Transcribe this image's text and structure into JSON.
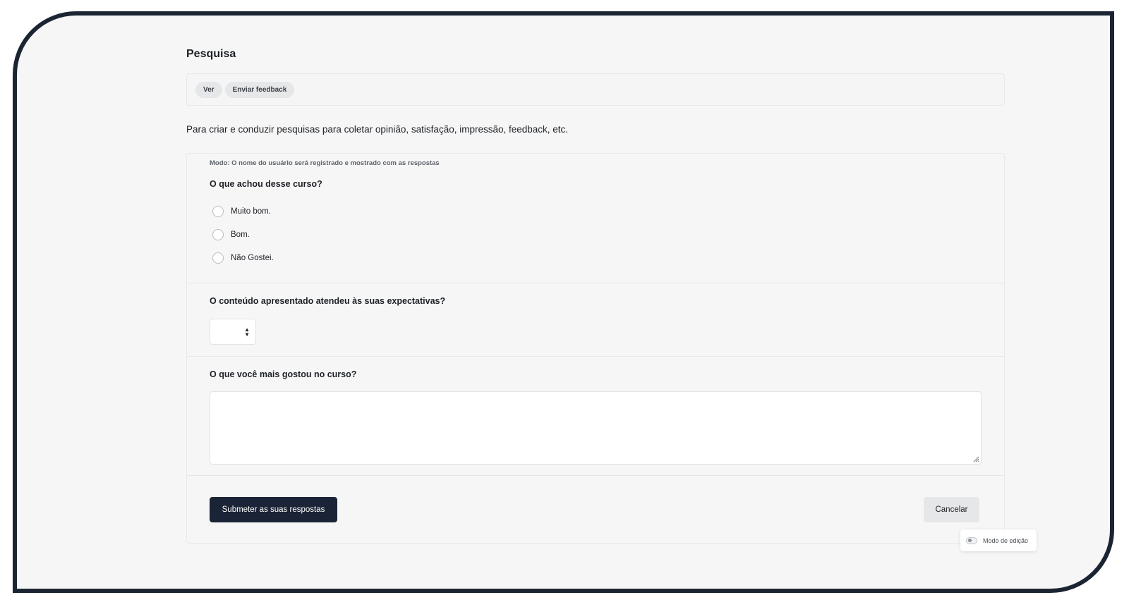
{
  "page": {
    "title": "Pesquisa",
    "description": "Para criar e conduzir pesquisas para coletar opinião, satisfação, impressão, feedback, etc."
  },
  "tabs": [
    {
      "label": "Ver"
    },
    {
      "label": "Enviar feedback"
    }
  ],
  "form": {
    "mode_note": "Modo: O nome do usuário será registrado e mostrado com as respostas",
    "questions": [
      {
        "title": "O que achou desse curso?",
        "type": "radio",
        "options": [
          "Muito bom.",
          "Bom.",
          "Não Gostei."
        ]
      },
      {
        "title": "O conteúdo apresentado atendeu às suas expectativas?",
        "type": "select",
        "value": ""
      },
      {
        "title": "O que você mais gostou no curso?",
        "type": "textarea",
        "value": ""
      }
    ],
    "submit_label": "Submeter as suas respostas",
    "cancel_label": "Cancelar"
  },
  "edit_mode": {
    "label": "Modo de edição",
    "enabled": false
  },
  "colors": {
    "primary_button": "#1b2436",
    "frame_border": "#1b2433"
  }
}
